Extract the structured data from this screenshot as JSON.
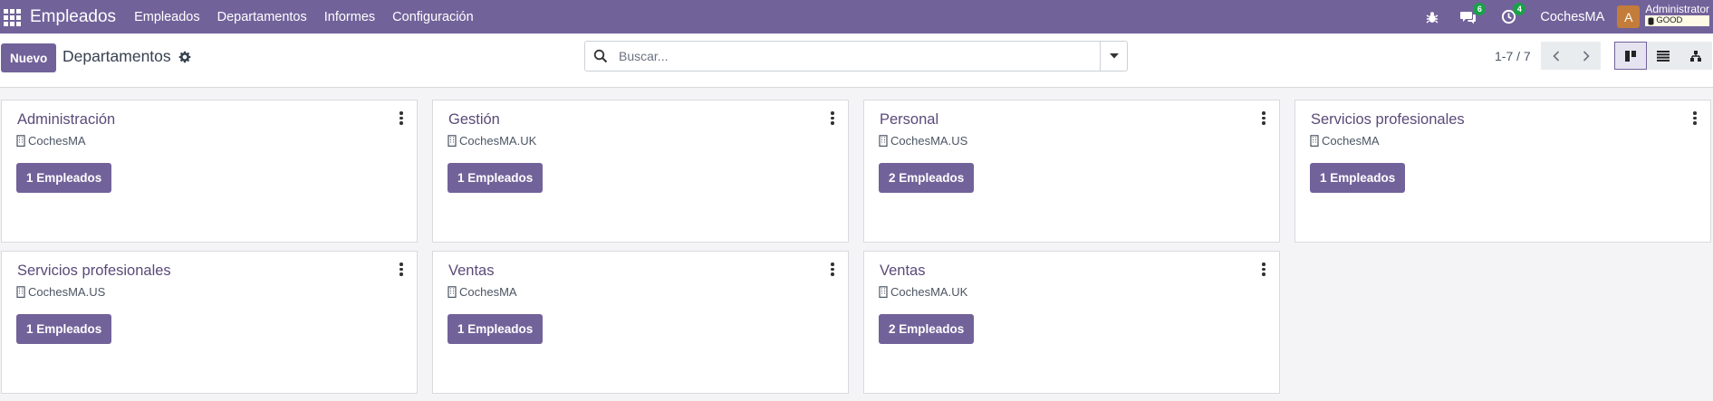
{
  "navbar": {
    "app_title": "Empleados",
    "menu": [
      "Empleados",
      "Departamentos",
      "Informes",
      "Configuración"
    ],
    "messages_count": "6",
    "activities_count": "4",
    "company": "CochesMA",
    "avatar_letter": "A",
    "user_name": "Administrator",
    "db_label": "GOOD"
  },
  "control": {
    "new_label": "Nuevo",
    "breadcrumb": "Departamentos",
    "search_placeholder": "Buscar...",
    "pager": "1-7 / 7"
  },
  "cards": [
    {
      "title": "Administración",
      "company": "CochesMA",
      "button": "1 Empleados"
    },
    {
      "title": "Gestión",
      "company": "CochesMA.UK",
      "button": "1 Empleados"
    },
    {
      "title": "Personal",
      "company": "CochesMA.US",
      "button": "2 Empleados"
    },
    {
      "title": "Servicios profesionales",
      "company": "CochesMA",
      "button": "1 Empleados"
    },
    {
      "title": "Servicios profesionales",
      "company": "CochesMA.US",
      "button": "1 Empleados"
    },
    {
      "title": "Ventas",
      "company": "CochesMA",
      "button": "1 Empleados"
    },
    {
      "title": "Ventas",
      "company": "CochesMA.UK",
      "button": "2 Empleados"
    }
  ],
  "colors": {
    "brand": "#72629a",
    "badge_green": "#1aa04a",
    "avatar": "#c47c3a"
  }
}
